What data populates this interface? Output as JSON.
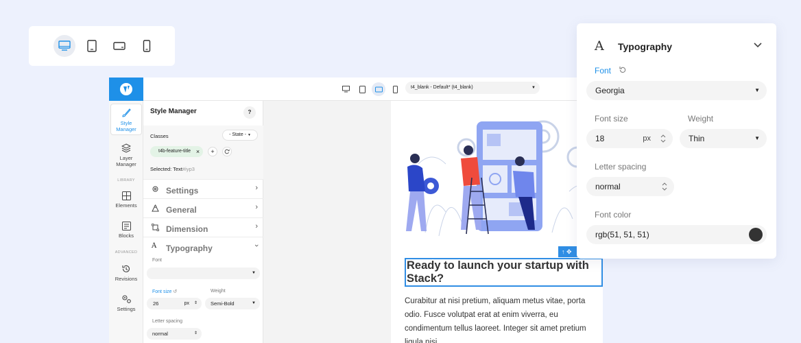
{
  "device_bar": {
    "items": [
      {
        "icon": "desktop-icon",
        "active": true
      },
      {
        "icon": "tablet-icon",
        "active": false
      },
      {
        "icon": "tablet-landscape-icon",
        "active": false
      },
      {
        "icon": "mobile-icon",
        "active": false
      }
    ]
  },
  "editor": {
    "theme_select": "t4_blank - Default* (t4_blank)",
    "rail": {
      "style_manager": "Style Manager",
      "layer_manager": "Layer Manager",
      "library_section": "LIBRARY",
      "elements": "Elements",
      "blocks": "Blocks",
      "advanced_section": "ADVANCED",
      "revisions": "Revisions",
      "settings": "Settings"
    },
    "panel": {
      "title": "Style Manager",
      "help": "?",
      "classes_label": "Classes",
      "state": "- State -",
      "class_tag": "t4b-feature-title",
      "selected_label": "Selected: Text",
      "selected_id": "#iyp3",
      "sections": {
        "settings": "Settings",
        "general": "General",
        "dimension": "Dimension",
        "typography": "Typography"
      },
      "font_label": "Font",
      "font_value": "",
      "font_size_label": "Font size",
      "font_size_value": "26",
      "font_size_unit": "px",
      "weight_label": "Weight",
      "weight_value": "Semi-Bold",
      "letter_spacing_label": "Letter spacing",
      "letter_spacing_value": "normal"
    },
    "canvas": {
      "heading": "Ready to launch your startup with Stack?",
      "body": "Curabitur at nisi pretium, aliquam metus vitae, porta odio. Fusce volutpat erat at enim viverra, eu condimentum tellus laoreet. Integer sit amet pretium ligula nisi."
    }
  },
  "typography_panel": {
    "title": "Typography",
    "font_label": "Font",
    "font_value": "Georgia",
    "font_size_label": "Font size",
    "font_size_value": "18",
    "font_size_unit": "px",
    "weight_label": "Weight",
    "weight_value": "Thin",
    "letter_spacing_label": "Letter spacing",
    "letter_spacing_value": "normal",
    "font_color_label": "Font color",
    "font_color_value": "rgb(51, 51, 51)"
  },
  "colors": {
    "accent": "#1e90e8",
    "background": "#edf1fd",
    "tag_bg": "#e3f3e6",
    "swatch": "#333333"
  }
}
